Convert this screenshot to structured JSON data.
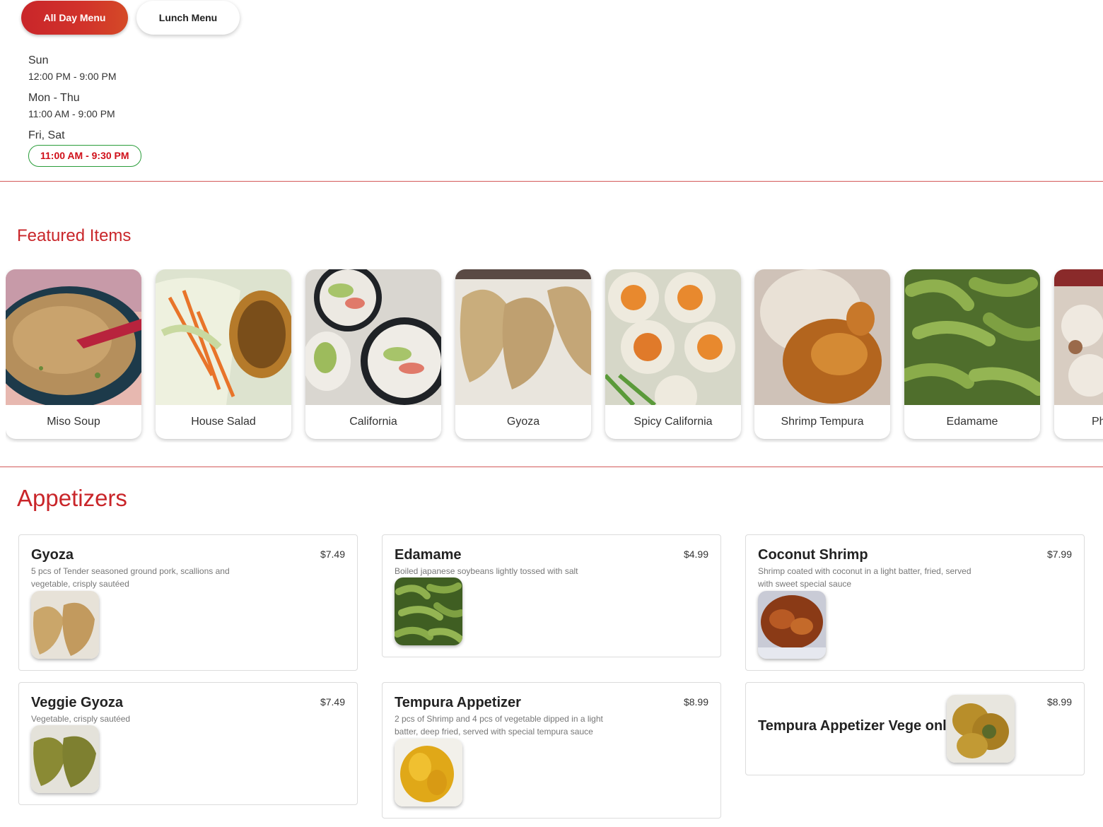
{
  "menu_tabs": {
    "all_day": "All Day Menu",
    "lunch": "Lunch Menu"
  },
  "hours": [
    {
      "day": "Sun",
      "time": "12:00 PM - 9:00 PM"
    },
    {
      "day": "Mon - Thu",
      "time": "11:00 AM - 9:00 PM"
    },
    {
      "day": "Fri, Sat",
      "time": "11:00 AM - 9:30 PM"
    }
  ],
  "featured": {
    "title": "Featured Items",
    "items": [
      {
        "label": "Miso Soup"
      },
      {
        "label": "House Salad"
      },
      {
        "label": "California"
      },
      {
        "label": "Gyoza"
      },
      {
        "label": "Spicy California"
      },
      {
        "label": "Shrimp Tempura"
      },
      {
        "label": "Edamame"
      },
      {
        "label": "Ph"
      }
    ]
  },
  "appetizers": {
    "title": "Appetizers",
    "items": [
      {
        "name": "Gyoza",
        "price": "$7.49",
        "desc": "5 pcs of Tender seasoned ground pork, scallions and vegetable, crisply sautéed"
      },
      {
        "name": "Edamame",
        "price": "$4.99",
        "desc": "Boiled japanese soybeans lightly tossed with salt"
      },
      {
        "name": "Coconut Shrimp",
        "price": "$7.99",
        "desc": "Shrimp coated with coconut in a light batter, fried, served with sweet special sauce"
      },
      {
        "name": "Veggie Gyoza",
        "price": "$7.49",
        "desc": "Vegetable, crisply sautéed"
      },
      {
        "name": "Tempura Appetizer",
        "price": "$8.99",
        "desc": "2 pcs of Shrimp and 4 pcs of vegetable dipped in a light batter, deep fried, served with special tempura sauce"
      },
      {
        "name": "Tempura Appetizer Vege only",
        "price": "$8.99"
      }
    ]
  },
  "colors": {
    "brand_red": "#c9262a",
    "current_hours_red": "#d0101a",
    "current_hours_border": "#2a9d3a"
  }
}
